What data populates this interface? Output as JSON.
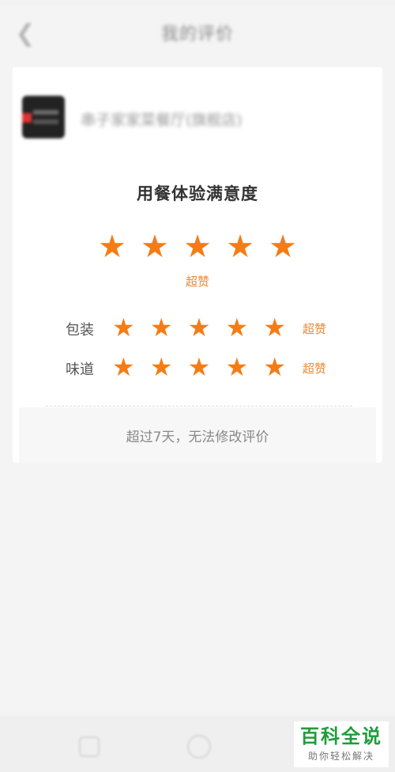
{
  "header": {
    "title": "我的评价",
    "back_icon": "chevron-left-icon"
  },
  "shop": {
    "name": "串子家家菜餐厅(旗舰店)"
  },
  "experience": {
    "title": "用餐体验满意度",
    "rating": 5,
    "max_rating": 5,
    "rating_label": "超赞"
  },
  "sub_ratings": [
    {
      "label": "包装",
      "rating": 5,
      "max_rating": 5,
      "rating_label": "超赞"
    },
    {
      "label": "味道",
      "rating": 5,
      "max_rating": 5,
      "rating_label": "超赞"
    }
  ],
  "notice": "超过7天，无法修改评价",
  "watermark": {
    "title": "百科全说",
    "subtitle": "助你轻松解决"
  },
  "colors": {
    "star": "#f57c14",
    "rating_text": "#e88a3a",
    "watermark_green": "#1e9e3a"
  }
}
